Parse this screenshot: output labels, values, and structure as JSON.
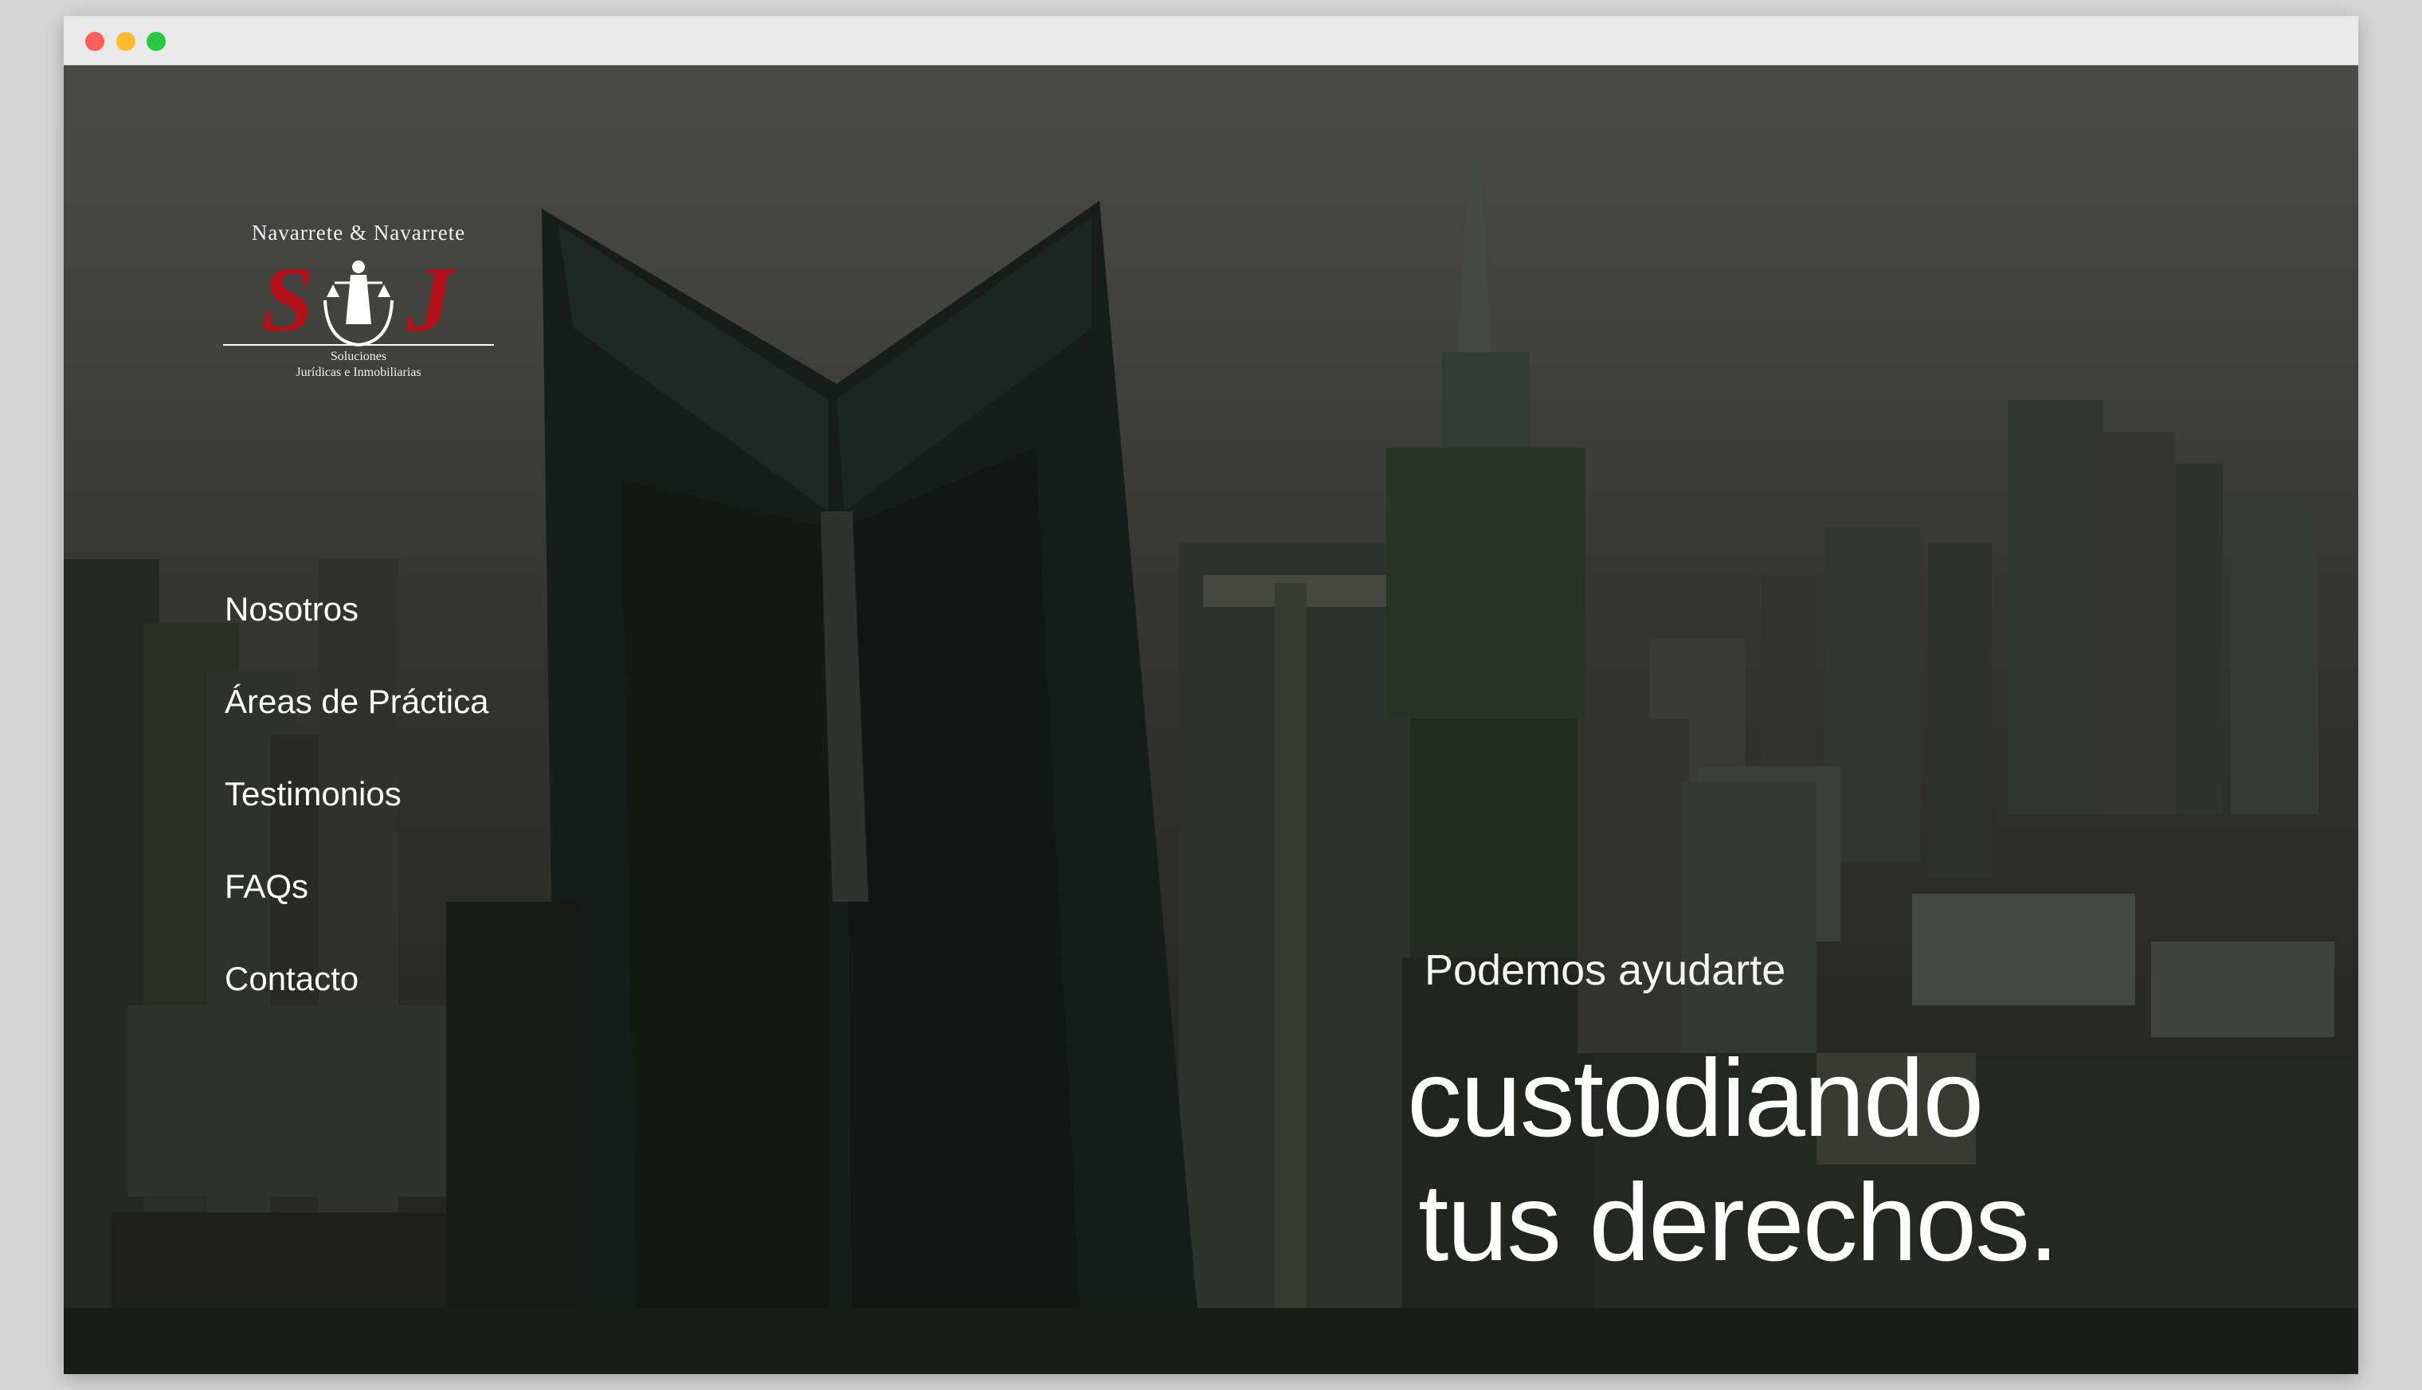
{
  "window": {
    "controls": [
      "close-button",
      "minimize-button",
      "zoom-button"
    ]
  },
  "logo": {
    "firm_name": "Navarrete & Navarrete",
    "monogram_left": "S",
    "monogram_right": "J",
    "tagline_line1": "Soluciones",
    "tagline_line2": "Jurídicas e Inmobiliarias",
    "accent_color": "#b3121b"
  },
  "nav": {
    "items": [
      {
        "label": "Nosotros"
      },
      {
        "label": "Áreas de Práctica"
      },
      {
        "label": "Testimonios"
      },
      {
        "label": "FAQs"
      },
      {
        "label": "Contacto"
      }
    ]
  },
  "hero": {
    "kicker": "Podemos ayudarte",
    "headline_line1": "custodiando",
    "headline_line2": "tus derechos."
  }
}
